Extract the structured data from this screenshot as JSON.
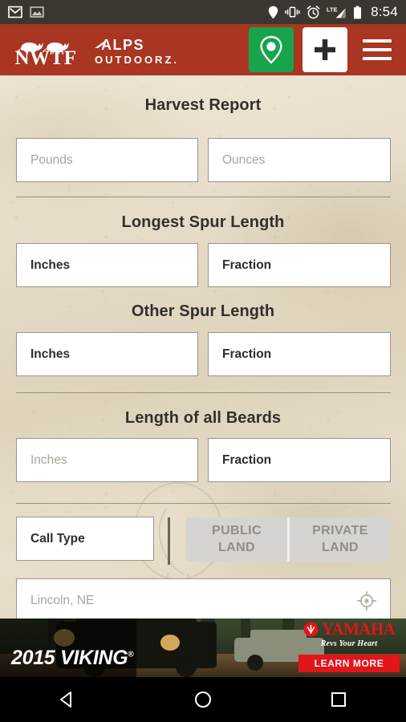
{
  "status_bar": {
    "time": "8:54",
    "left_icons": [
      "gmail-icon",
      "photo-icon"
    ],
    "right_icons": [
      "location-icon",
      "vibrate-icon",
      "alarm-icon",
      "lte-signal-icon",
      "battery-icon"
    ],
    "lte_label": "LTE",
    "background": "#3b3630"
  },
  "app_bar": {
    "background": "#a93523",
    "logo_primary": "NWTF",
    "logo_secondary_line1": "ALPS",
    "logo_secondary_line2": "OUTDOORZ.",
    "actions": [
      {
        "name": "locate-button",
        "icon": "map-pin-icon",
        "color": "#17a44a"
      },
      {
        "name": "add-button",
        "icon": "plus-icon",
        "color": "#ffffff"
      },
      {
        "name": "menu-button",
        "icon": "hamburger-menu-icon",
        "color": "#ffffff"
      }
    ]
  },
  "form": {
    "sections": [
      {
        "title": "Harvest Report",
        "fields": [
          {
            "name": "pounds-input",
            "value": "Pounds",
            "state": "placeholder"
          },
          {
            "name": "ounces-input",
            "value": "Ounces",
            "state": "placeholder"
          }
        ]
      },
      {
        "title": "Longest Spur Length",
        "fields": [
          {
            "name": "longest-spur-inches-input",
            "value": "Inches",
            "state": "filled"
          },
          {
            "name": "longest-spur-fraction-input",
            "value": "Fraction",
            "state": "filled"
          }
        ]
      },
      {
        "title": "Other Spur Length",
        "fields": [
          {
            "name": "other-spur-inches-input",
            "value": "Inches",
            "state": "filled"
          },
          {
            "name": "other-spur-fraction-input",
            "value": "Fraction",
            "state": "filled"
          }
        ]
      },
      {
        "title": "Length of all Beards",
        "fields": [
          {
            "name": "beards-inches-input",
            "value": "Inches",
            "state": "placeholder"
          },
          {
            "name": "beards-fraction-input",
            "value": "Fraction",
            "state": "filled"
          }
        ]
      }
    ],
    "call_type": {
      "label": "Call Type",
      "state": "filled"
    },
    "land_toggles": [
      {
        "name": "public-land-toggle",
        "line1": "PUBLIC",
        "line2": "LAND",
        "selected": false
      },
      {
        "name": "private-land-toggle",
        "line1": "PRIVATE",
        "line2": "LAND",
        "selected": false
      }
    ],
    "location": {
      "placeholder": "Lincoln, NE",
      "icon": "crosshair-target-icon"
    }
  },
  "ad": {
    "product": "2015 VIKING",
    "registered_mark": "®",
    "brand": "YAMAHA",
    "tagline": "Revs Your Heart",
    "cta": "LEARN MORE",
    "cta_color": "#e2151b"
  },
  "nav_bar": {
    "buttons": [
      {
        "name": "nav-back-button",
        "icon": "triangle-back-icon"
      },
      {
        "name": "nav-home-button",
        "icon": "circle-home-icon"
      },
      {
        "name": "nav-recents-button",
        "icon": "square-recents-icon"
      }
    ]
  }
}
